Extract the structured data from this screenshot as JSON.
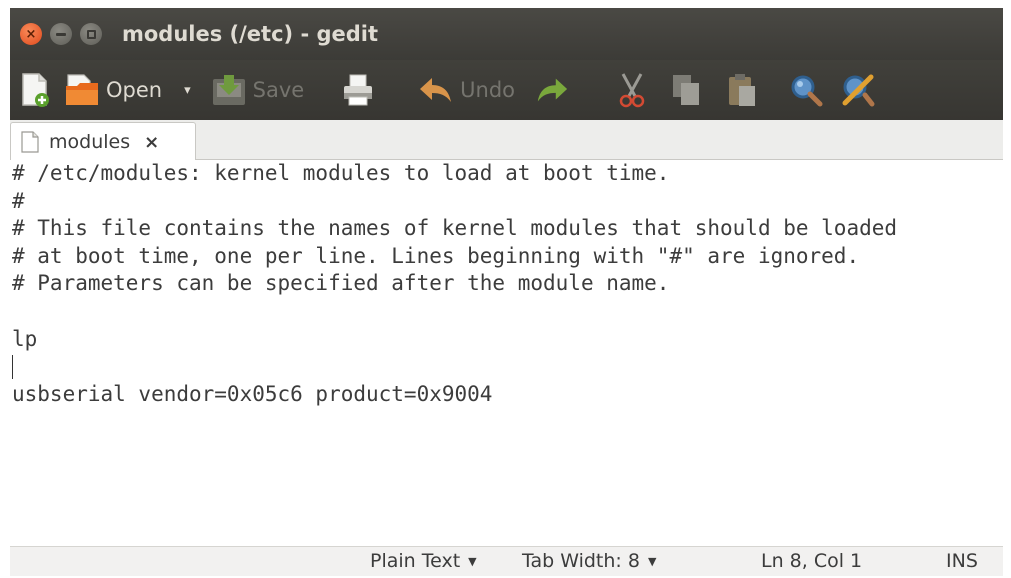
{
  "window": {
    "title": "modules (/etc) - gedit",
    "controls": {
      "close_glyph": "×",
      "min_icon": "minimize-icon",
      "max_icon": "maximize-icon"
    }
  },
  "toolbar": {
    "new_icon": "new-document-icon",
    "open_label": "Open",
    "open_dropdown": "▾",
    "save_label": "Save",
    "print_icon": "print-icon",
    "undo_label": "Undo",
    "redo_icon": "redo-icon",
    "cut_icon": "cut-icon",
    "copy_icon": "copy-icon",
    "paste_icon": "paste-icon",
    "find_icon": "search-icon",
    "replace_icon": "find-replace-icon"
  },
  "tabs": [
    {
      "label": "modules",
      "close": "×",
      "active": true
    }
  ],
  "editor": {
    "lines": [
      "# /etc/modules: kernel modules to load at boot time.",
      "#",
      "# This file contains the names of kernel modules that should be loaded",
      "# at boot time, one per line. Lines beginning with \"#\" are ignored.",
      "# Parameters can be specified after the module name.",
      "",
      "lp",
      "",
      "usbserial vendor=0x05c6 product=0x9004"
    ],
    "cursor_line": 8
  },
  "statusbar": {
    "language": "Plain Text",
    "tab_width": "Tab Width: 8",
    "position": "Ln 8, Col 1",
    "mode": "INS"
  },
  "colors": {
    "titlebar": "#3c3b37",
    "close_button": "#e0491c",
    "editor_bg": "#ffffff",
    "text": "#3c3c3c"
  }
}
